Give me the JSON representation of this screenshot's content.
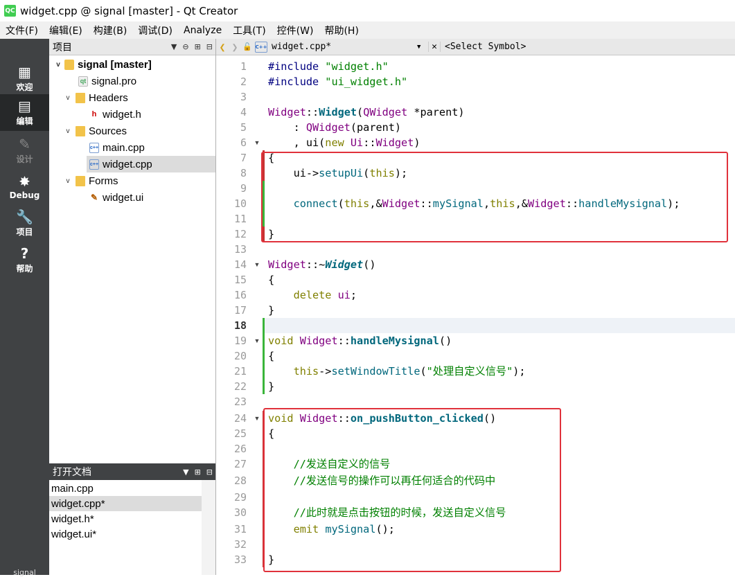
{
  "window": {
    "title": "widget.cpp @ signal [master] - Qt Creator",
    "logo_text": "QC"
  },
  "menu": [
    "文件(F)",
    "编辑(E)",
    "构建(B)",
    "调试(D)",
    "Analyze",
    "工具(T)",
    "控件(W)",
    "帮助(H)"
  ],
  "modes": [
    {
      "label": "欢迎",
      "icon": "▦"
    },
    {
      "label": "编辑",
      "icon": "▤"
    },
    {
      "label": "设计",
      "icon": "✎"
    },
    {
      "label": "Debug",
      "icon": "✸"
    },
    {
      "label": "项目",
      "icon": "🔧"
    },
    {
      "label": "帮助",
      "icon": "?"
    }
  ],
  "mode_bottom": "signal",
  "project_pane": {
    "title": "项目",
    "icons": {
      "filter": "▼",
      "link": "⊖",
      "split": "⊞",
      "close": "⊟"
    }
  },
  "tree": [
    {
      "label": "signal [master]",
      "arrow": "v"
    },
    {
      "label": "signal.pro",
      "icon": "qt"
    },
    {
      "label": "Headers",
      "arrow": "v"
    },
    {
      "label": "widget.h",
      "icon": "h"
    },
    {
      "label": "Sources",
      "arrow": "v"
    },
    {
      "label": "main.cpp",
      "icon": "c++"
    },
    {
      "label": "widget.cpp",
      "icon": "c++"
    },
    {
      "label": "Forms",
      "arrow": "v"
    },
    {
      "label": "widget.ui",
      "icon": "✎"
    }
  ],
  "open_docs": {
    "title": "打开文档",
    "items": [
      "main.cpp",
      "widget.cpp*",
      "widget.h*",
      "widget.ui*"
    ]
  },
  "editor_toolbar": {
    "back": "❮",
    "forward": "❯",
    "lock": "🔓",
    "file_badge": "C++",
    "file": "widget.cpp*",
    "combo_arrow": "▼",
    "close": "✕",
    "symbol": "<Select Symbol>"
  },
  "line_numbers": [
    "1",
    "2",
    "3",
    "4",
    "5",
    "6",
    "7",
    "8",
    "9",
    "10",
    "11",
    "12",
    "13",
    "14",
    "15",
    "16",
    "17",
    "18",
    "19",
    "20",
    "21",
    "22",
    "23",
    "24",
    "25",
    "26",
    "27",
    "28",
    "29",
    "30",
    "31",
    "32",
    "33"
  ],
  "code": {
    "l1": [
      "#include ",
      "\"widget.h\""
    ],
    "l2": [
      "#include ",
      "\"ui_widget.h\""
    ],
    "l4": [
      "Widget",
      "::",
      "Widget",
      "(",
      "QWidget",
      " *parent)"
    ],
    "l5": [
      "    : ",
      "QWidget",
      "(parent)"
    ],
    "l6": [
      "    , ui(",
      "new",
      " ",
      "Ui",
      "::",
      "Widget",
      ")"
    ],
    "l7": [
      "{"
    ],
    "l8": [
      "    ui->",
      "setupUi",
      "(",
      "this",
      ");"
    ],
    "l10": [
      "    ",
      "connect",
      "(",
      "this",
      ",&",
      "Widget",
      "::",
      "mySignal",
      ",",
      "this",
      ",&",
      "Widget",
      "::",
      "handleMysignal",
      ");"
    ],
    "l12": [
      "}"
    ],
    "l14": [
      "Widget",
      "::~",
      "Widget",
      "()"
    ],
    "l15": [
      "{"
    ],
    "l16": [
      "    ",
      "delete",
      " ",
      "ui",
      ";"
    ],
    "l17": [
      "}"
    ],
    "l19": [
      "void",
      " ",
      "Widget",
      "::",
      "handleMysignal",
      "()"
    ],
    "l20": [
      "{"
    ],
    "l21": [
      "    ",
      "this",
      "->",
      "setWindowTitle",
      "(",
      "\"处理自定义信号\"",
      ");"
    ],
    "l22": [
      "}"
    ],
    "l24": [
      "void",
      " ",
      "Widget",
      "::",
      "on_pushButton_clicked",
      "()"
    ],
    "l25": [
      "{"
    ],
    "l27": [
      "    ",
      "//发送自定义的信号"
    ],
    "l28": [
      "    ",
      "//发送信号的操作可以再任何适合的代码中"
    ],
    "l30": [
      "    ",
      "//此时就是点击按钮的时候，发送自定义信号"
    ],
    "l31": [
      "    ",
      "emit",
      " ",
      "mySignal",
      "();"
    ],
    "l33": [
      "}"
    ]
  },
  "colors": {
    "highlight_box": "#e0313b",
    "change_green": "#3ab53a",
    "change_red": "#c83232",
    "mode_bar": "#404244"
  }
}
